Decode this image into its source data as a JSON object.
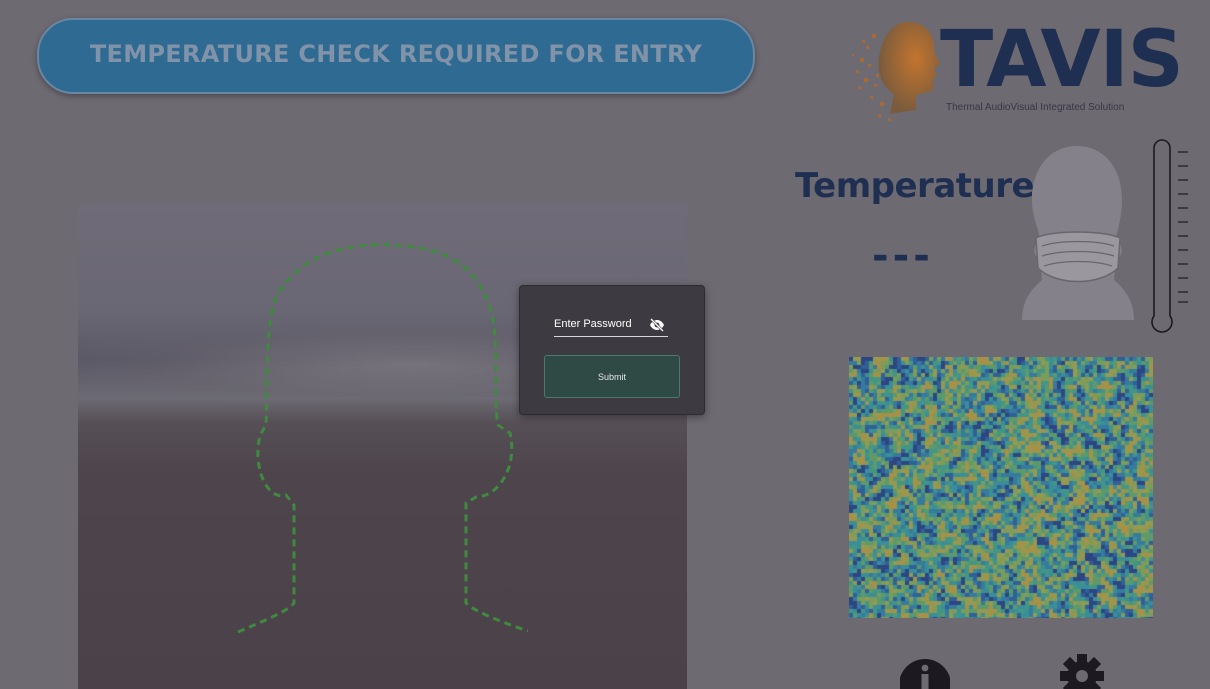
{
  "banner": {
    "text": "TEMPERATURE CHECK REQUIRED FOR ENTRY"
  },
  "logo": {
    "word": "TAVIS",
    "subtitle": "Thermal AudioVisual Integrated Solution"
  },
  "temperature": {
    "title": "Temperature",
    "value": "---"
  },
  "password_dialog": {
    "label": "Enter Password",
    "submit_label": "Submit",
    "visibility_icon": "eye-off-icon"
  },
  "icons": {
    "info": "info-icon",
    "settings": "gear-icon",
    "head": "masked-head-icon",
    "thermometer": "thermometer-icon"
  },
  "colors": {
    "banner": "#2f6a92",
    "brand": "#1e2f52",
    "guide": "#3f8a3f",
    "submit": "#2f4a45"
  }
}
